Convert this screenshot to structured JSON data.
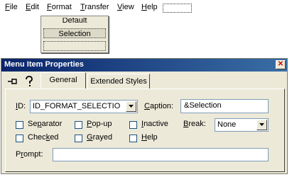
{
  "menubar": {
    "items": [
      {
        "pre": "",
        "u": "F",
        "post": "ile"
      },
      {
        "pre": "",
        "u": "E",
        "post": "dit"
      },
      {
        "pre": "",
        "u": "F",
        "post": "ormat"
      },
      {
        "pre": "",
        "u": "T",
        "post": "ransfer"
      },
      {
        "pre": "",
        "u": "V",
        "post": "iew"
      },
      {
        "pre": "",
        "u": "H",
        "post": "elp"
      }
    ]
  },
  "dropdown": {
    "default_label": "Default",
    "selection_label": "Selection"
  },
  "dialog": {
    "title": "Menu Item Properties",
    "close_glyph": "✕",
    "tabs": {
      "general": "General",
      "extended": "Extended Styles"
    },
    "id_label_u": "I",
    "id_label_rest": "D:",
    "id_value": "ID_FORMAT_SELECTIO",
    "caption_label_u": "C",
    "caption_label_rest": "aption:",
    "caption_value": "&Selection",
    "checkboxes": {
      "separator": {
        "pre": "Se",
        "u": "p",
        "post": "arator"
      },
      "popup": {
        "pre": "",
        "u": "P",
        "post": "op-up"
      },
      "inactive": {
        "pre": "",
        "u": "I",
        "post": "nactive"
      },
      "checked": {
        "pre": "Chec",
        "u": "k",
        "post": "ed"
      },
      "grayed": {
        "pre": "",
        "u": "G",
        "post": "rayed"
      },
      "help": {
        "pre": "",
        "u": "H",
        "post": "elp"
      }
    },
    "break_label_u": "B",
    "break_label_rest": "reak:",
    "break_value": "None",
    "prompt_label_pre": "P",
    "prompt_label_u": "r",
    "prompt_label_post": "ompt:",
    "prompt_value": ""
  }
}
